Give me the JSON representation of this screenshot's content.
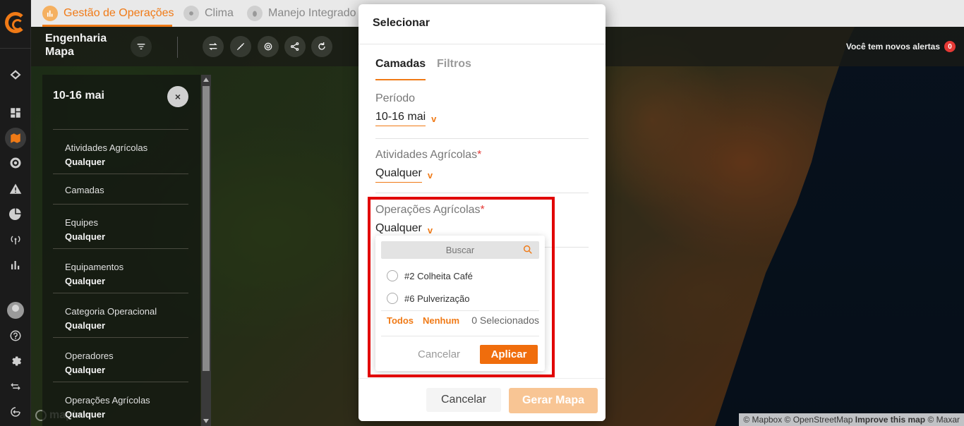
{
  "top_tabs": [
    {
      "label": "Gestão de Operações",
      "icon": "chart-icon",
      "active": true
    },
    {
      "label": "Clima",
      "icon": "sun-icon",
      "active": false
    },
    {
      "label": "Manejo Integrado",
      "icon": "bug-icon",
      "active": false
    }
  ],
  "header": {
    "title_line1": "Engenharia",
    "title_line2": "Mapa",
    "alerts_text": "Você tem novos alertas",
    "alerts_count": "0"
  },
  "filter_panel": {
    "date": "10-16 mai",
    "close_label": "×",
    "items": [
      {
        "label": "Atividades Agrícolas",
        "value": "Qualquer"
      },
      {
        "label": "Camadas",
        "value": ""
      },
      {
        "label": "Equipes",
        "value": "Qualquer"
      },
      {
        "label": "Equipamentos",
        "value": "Qualquer"
      },
      {
        "label": "Categoria Operacional",
        "value": "Qualquer"
      },
      {
        "label": "Operadores",
        "value": "Qualquer"
      },
      {
        "label": "Operações Agrícolas",
        "value": "Qualquer"
      }
    ]
  },
  "modal": {
    "title": "Selecionar",
    "tabs": [
      "Camadas",
      "Filtros"
    ],
    "periodo_label": "Período",
    "periodo_value": "10-16 mai",
    "atividades_label": "Atividades Agrícolas",
    "atividades_value": "Qualquer",
    "operacoes_label": "Operações Agrícolas",
    "operacoes_value": "Qualquer",
    "required_mark": "*",
    "chevron": "v",
    "dropdown": {
      "search_placeholder": "Buscar",
      "options": [
        "#2 Colheita Café",
        "#6 Pulverização"
      ],
      "all_label": "Todos",
      "none_label": "Nenhum",
      "selected_count": "0 Selecionados",
      "cancel_label": "Cancelar",
      "apply_label": "Aplicar"
    },
    "footer_cancel": "Cancelar",
    "footer_generate": "Gerar Mapa"
  },
  "map": {
    "attribution_prefix": "© Mapbox © OpenStreetMap",
    "attribution_improve": "Improve this map",
    "attribution_suffix": "© Maxar",
    "logo_text": "mapbox"
  },
  "colors": {
    "accent": "#f07a16",
    "alert_badge": "#e53935",
    "highlight": "#e10000"
  }
}
